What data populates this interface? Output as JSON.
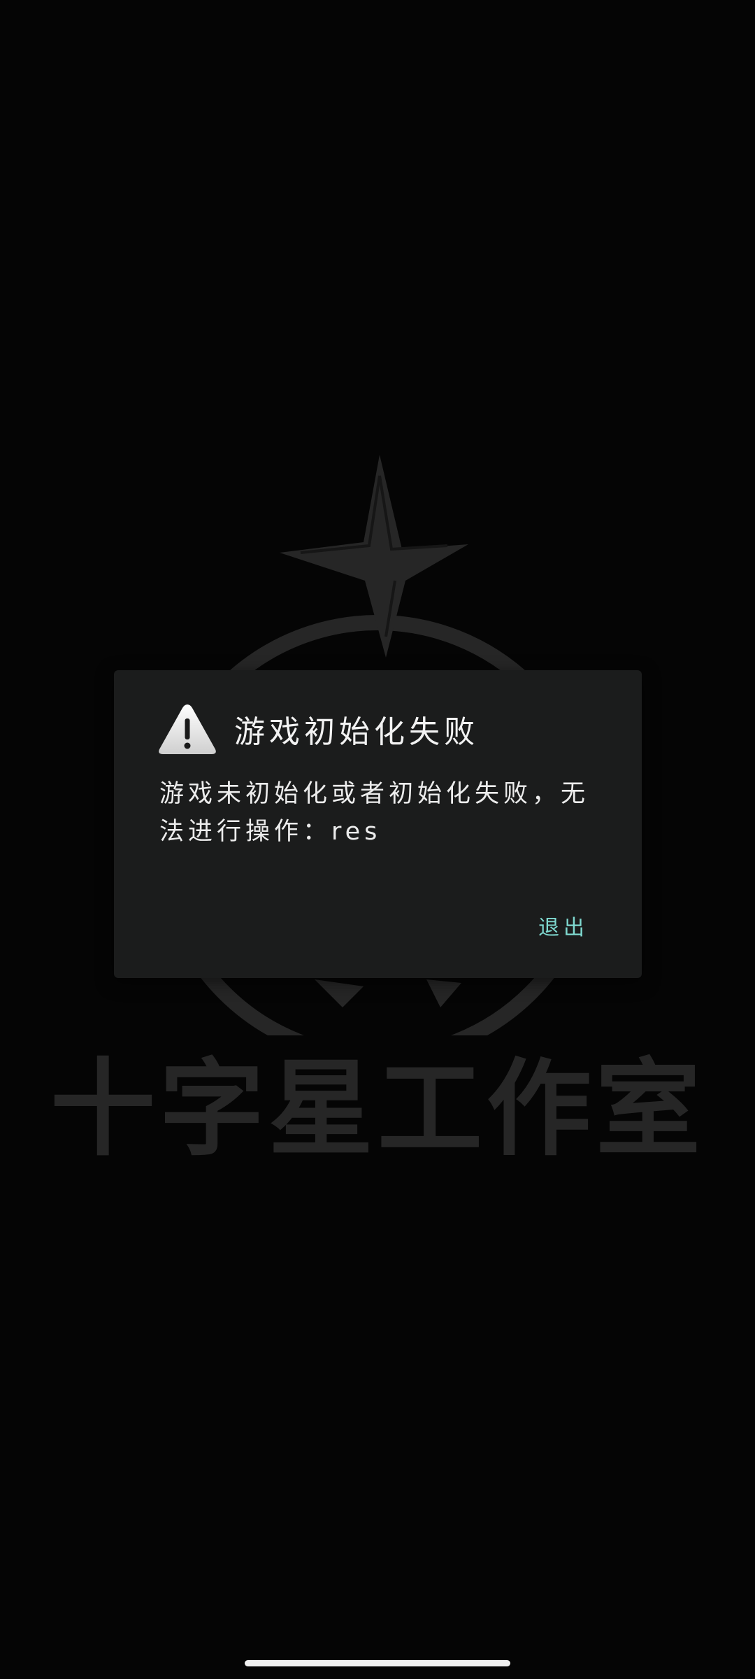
{
  "studio": {
    "name": "十字星工作室"
  },
  "dialog": {
    "title": "游戏初始化失败",
    "message": "游戏未初始化或者初始化失败，无法进行操作：res",
    "exit_label": "退出",
    "icon": "warning-icon"
  },
  "colors": {
    "background": "#050505",
    "dialog_background": "#1b1c1c",
    "accent": "#7fd9d0",
    "logo": "#262626"
  }
}
